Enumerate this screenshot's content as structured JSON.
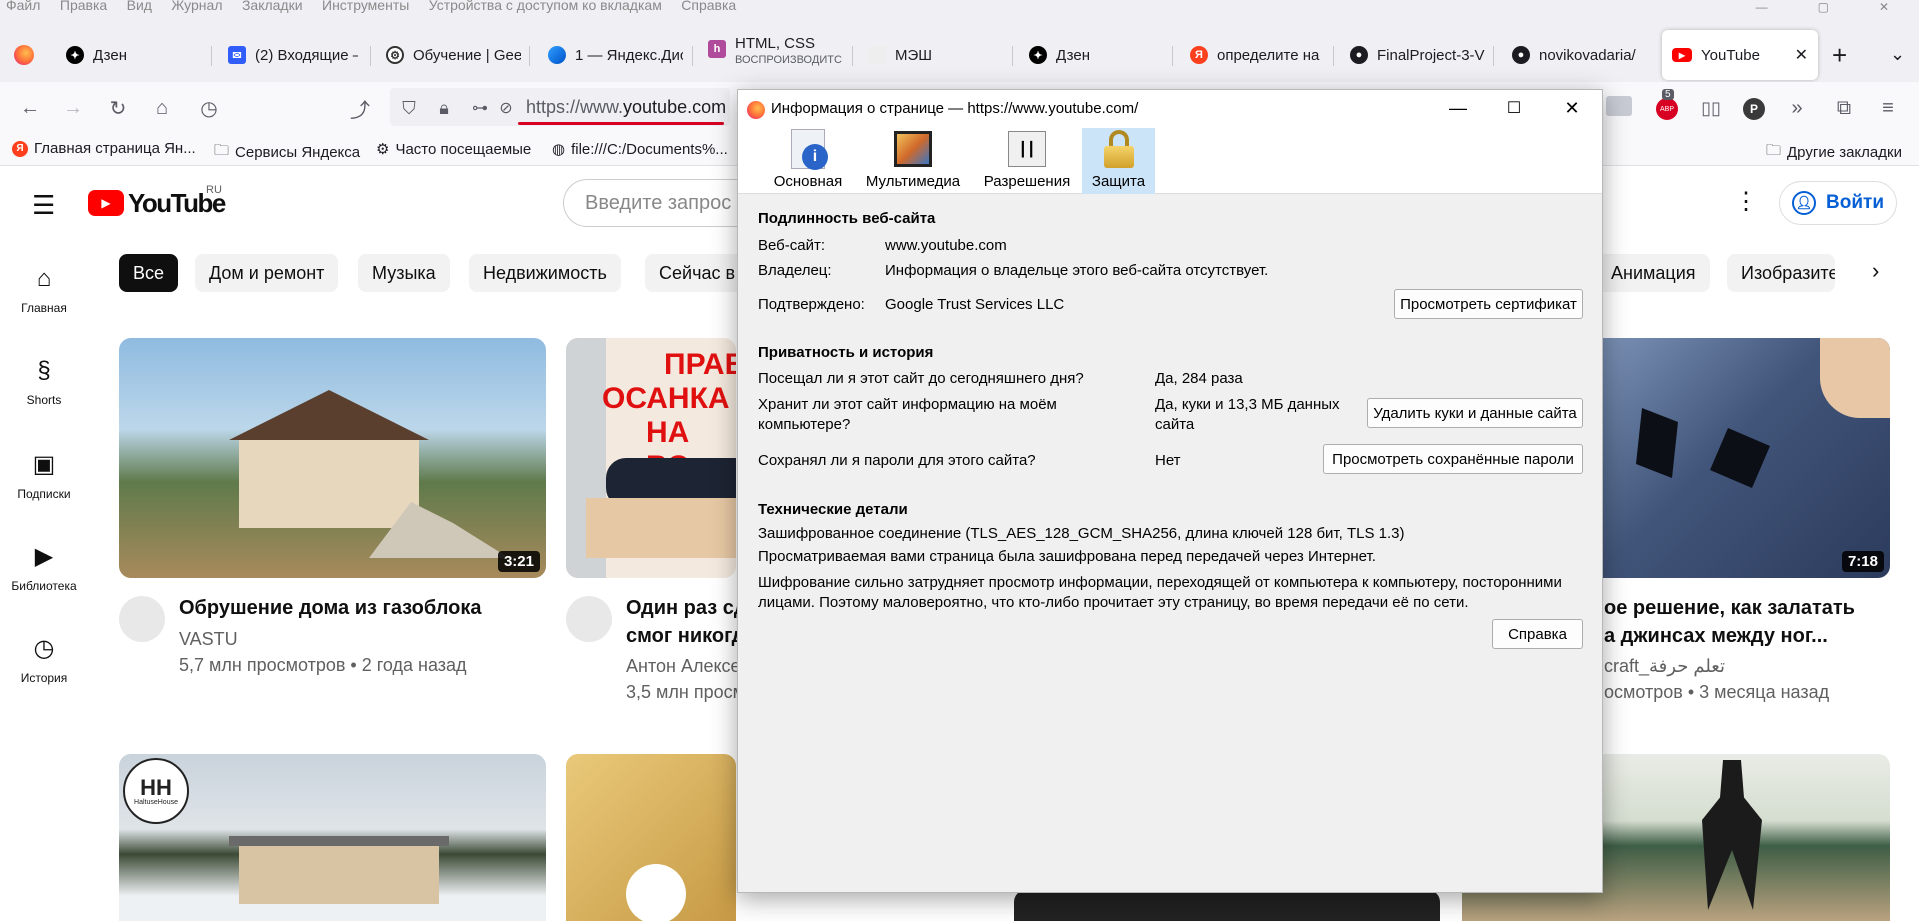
{
  "menubar": {
    "items": [
      "Файл",
      "Правка",
      "Вид",
      "Журнал",
      "Закладки",
      "Инструменты",
      "Устройства с доступом ко вкладкам",
      "Справка"
    ]
  },
  "tabs": [
    {
      "label": "Дзен",
      "icon": "dzen-icon"
    },
    {
      "label": "(2) Входящие –",
      "icon": "mail-icon"
    },
    {
      "label": "Обучение | Gee",
      "icon": "openai-icon"
    },
    {
      "label": "1 — Яндекс.Дис",
      "icon": "yandex-disk-icon"
    },
    {
      "label": "HTML, CSS",
      "sublabel": "ВОСПРОИЗВОДИТС",
      "icon": "html-icon"
    },
    {
      "label": "МЭШ",
      "icon": "mesh-icon"
    },
    {
      "label": "Дзен",
      "icon": "dzen-icon"
    },
    {
      "label": "определите на",
      "icon": "yandex-icon"
    },
    {
      "label": "FinalProject-3-V",
      "icon": "github-icon"
    },
    {
      "label": "novikovadaria/",
      "icon": "github-icon"
    },
    {
      "label": "YouTube",
      "icon": "youtube-icon",
      "active": true
    }
  ],
  "url": {
    "prefix": "https://www.",
    "domain": "youtube.com"
  },
  "bookmarks": [
    "Главная страница Ян...",
    "Сервисы Яндекса",
    "Часто посещаемые",
    "file:///C:/Documents%...",
    "Другие закладки"
  ],
  "youtube": {
    "logo": "YouTube",
    "region": "RU",
    "search_placeholder": "Введите запрос",
    "signin": "Войти",
    "sidebar": [
      "Главная",
      "Shorts",
      "Подписки",
      "Библиотека",
      "История"
    ],
    "chips": [
      "Все",
      "Дом и ремонт",
      "Музыка",
      "Недвижимость",
      "Сейчас в",
      "Анимация",
      "Изобразите"
    ],
    "videos": [
      {
        "title": "Обрушение дома из газоблока",
        "channel": "VASTU",
        "stats": "5,7 млн просмотров • 2 года назад",
        "duration": "3:21"
      },
      {
        "title_line1": "Один раз сд",
        "title_line2": "смог никогд",
        "channel": "Антон Алексе",
        "stats": "3,5 млн просм",
        "thumb_text": [
          "ПРАВ",
          "ОСАНКА",
          "НА ВО"
        ]
      },
      {
        "title_line1": "ое решение, как залатать",
        "title_line2": "а джинсах между ног...",
        "channel": "craft_تعلم حرفة",
        "stats": "осмотров • 3 месяца назад",
        "duration": "7:18"
      }
    ],
    "thumb2_logo": "HaltuseHouse"
  },
  "dialog": {
    "title": "Информация о странице — https://www.youtube.com/",
    "tabs": [
      "Основная",
      "Мультимедиа",
      "Разрешения",
      "Защита"
    ],
    "identity": {
      "heading": "Подлинность веб-сайта",
      "website_label": "Веб-сайт:",
      "website_value": "www.youtube.com",
      "owner_label": "Владелец:",
      "owner_value": "Информация о владельце этого веб-сайта отсутствует.",
      "verified_label": "Подтверждено:",
      "verified_value": "Google Trust Services LLC",
      "cert_button": "Просмотреть сертификат"
    },
    "privacy": {
      "heading": "Приватность и история",
      "visited_q": "Посещал ли я этот сайт до сегодняшнего дня?",
      "visited_a": "Да, 284 раза",
      "stores_q1": "Хранит ли этот сайт информацию на моём",
      "stores_q2": "компьютере?",
      "stores_a1": "Да, куки и 13,3 МБ данных",
      "stores_a2": "сайта",
      "clear_button": "Удалить куки и данные сайта",
      "passwords_q": "Сохранял ли я пароли для этого сайта?",
      "passwords_a": "Нет",
      "passwords_button": "Просмотреть сохранённые пароли"
    },
    "technical": {
      "heading": "Технические детали",
      "line1": "Зашифрованное соединение (TLS_AES_128_GCM_SHA256, длина ключей 128 бит, TLS 1.3)",
      "line2": "Просматриваемая вами страница была зашифрована перед передачей через Интернет.",
      "line3a": "Шифрование сильно затрудняет просмотр информации, переходящей от компьютера к компьютеру, посторонними",
      "line3b": "лицами. Поэтому маловероятно, что кто-либо прочитает эту страницу, во время передачи её по сети."
    },
    "help_button": "Справка"
  },
  "toolbar_badges": {
    "extensions_count": "5",
    "abp_label": "ABP"
  }
}
